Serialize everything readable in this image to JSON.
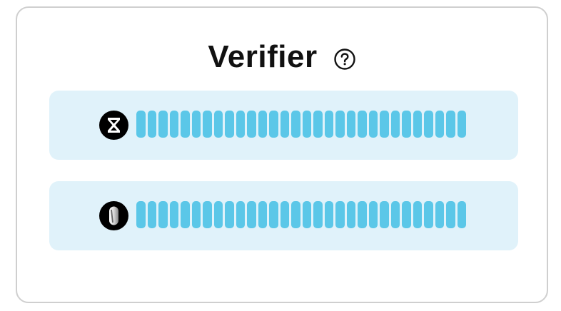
{
  "verifier": {
    "title": "Verifier",
    "help_icon": "question-circle-icon",
    "rows": [
      {
        "icon": "hourglass-icon",
        "segments": 30,
        "bar_color": "#5bc7e8"
      },
      {
        "icon": "pill-token-icon",
        "segments": 30,
        "bar_color": "#5bc7e8"
      }
    ],
    "colors": {
      "row_background": "#e0f2fa",
      "segment": "#5bc7e8",
      "border": "#cfcfcf"
    }
  }
}
